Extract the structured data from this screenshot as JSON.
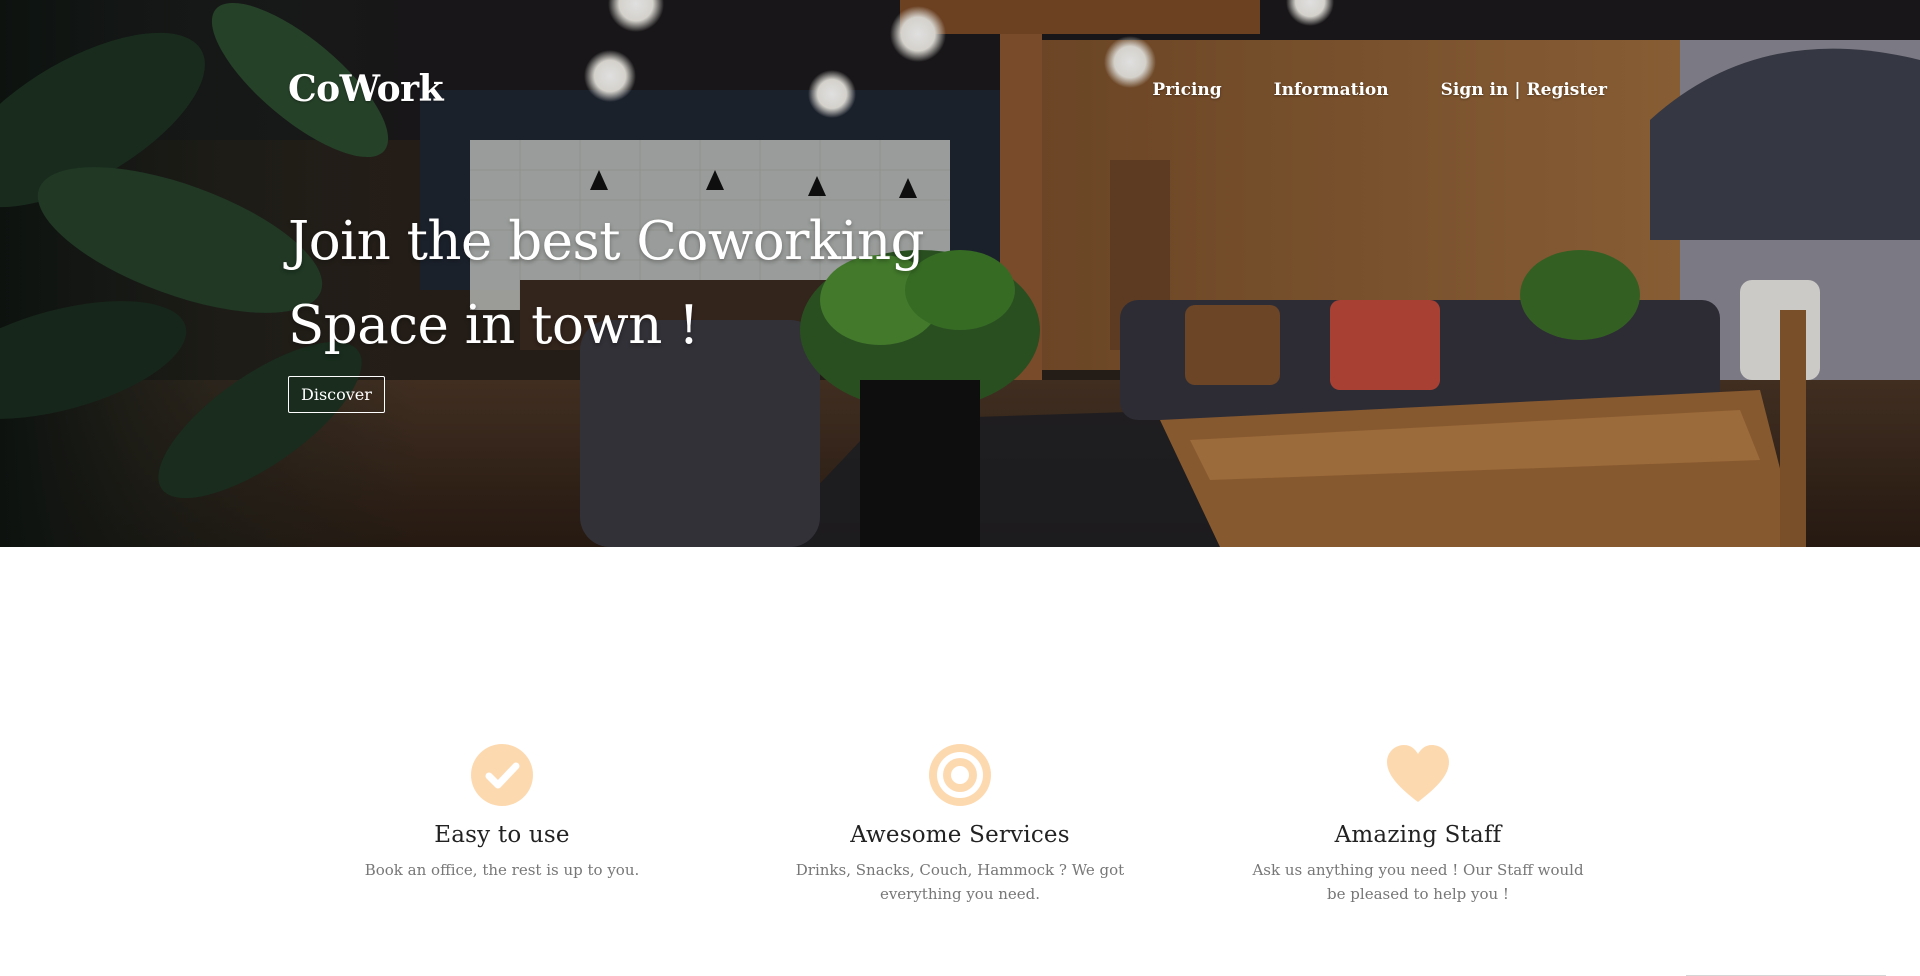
{
  "brand": "CoWork",
  "nav": {
    "pricing": "Pricing",
    "information": "Information",
    "sign_in": "Sign in",
    "separator": "|",
    "register": "Register"
  },
  "hero": {
    "headline": "Join the best Coworking Space in town !",
    "cta": "Discover"
  },
  "features": [
    {
      "icon": "check-circle-icon",
      "title": "Easy to use",
      "text": "Book an office, the rest is up to you."
    },
    {
      "icon": "target-icon",
      "title": "Awesome Services",
      "text": "Drinks, Snacks, Couch, Hammock ? We got everything you need."
    },
    {
      "icon": "heart-icon",
      "title": "Amazing Staff",
      "text": "Ask us anything you need ! Our Staff would be pleased to help you !"
    }
  ],
  "colors": {
    "accent": "#fdd9b0",
    "hero_text": "#ffffff",
    "feature_title": "#222222",
    "feature_text": "#777777"
  }
}
